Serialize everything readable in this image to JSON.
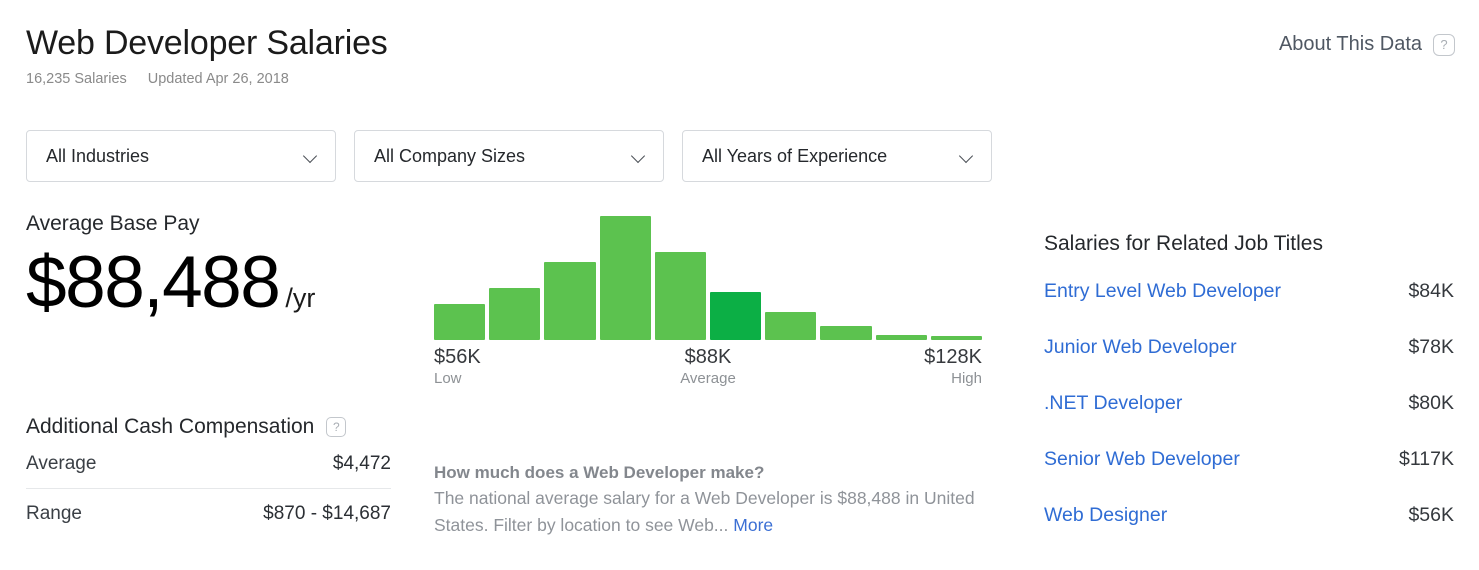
{
  "header": {
    "title": "Web Developer Salaries",
    "salary_count": "16,235 Salaries",
    "updated": "Updated Apr 26, 2018",
    "about_label": "About This Data",
    "help_glyph": "?"
  },
  "filters": [
    {
      "label": "All Industries"
    },
    {
      "label": "All Company Sizes"
    },
    {
      "label": "All Years of Experience"
    }
  ],
  "base_pay": {
    "label": "Average Base Pay",
    "amount": "$88,488",
    "period": "/yr"
  },
  "additional_cash": {
    "label": "Additional Cash Compensation",
    "help_glyph": "?",
    "rows": [
      {
        "label": "Average",
        "value": "$4,472"
      },
      {
        "label": "Range",
        "value": "$870 - $14,687"
      }
    ]
  },
  "description": {
    "question": "How much does a Web Developer make?",
    "body": "The national average salary for a Web Developer is $88,488 in United States. Filter by location to see Web...",
    "more_label": "More"
  },
  "related": {
    "heading": "Salaries for Related Job Titles",
    "items": [
      {
        "title": "Entry Level Web Developer",
        "pay": "$84K"
      },
      {
        "title": "Junior Web Developer",
        "pay": "$78K"
      },
      {
        "title": ".NET Developer",
        "pay": "$80K"
      },
      {
        "title": "Senior Web Developer",
        "pay": "$117K"
      },
      {
        "title": "Web Designer",
        "pay": "$56K"
      }
    ]
  },
  "chart_data": {
    "type": "bar",
    "title": "Base pay salary distribution",
    "xlabel": "",
    "ylabel": "",
    "grid": false,
    "legend": false,
    "categories": [
      "b1",
      "b2",
      "b3",
      "b4",
      "b5",
      "b6",
      "b7",
      "b8",
      "b9",
      "b10"
    ],
    "values": [
      36,
      52,
      78,
      124,
      88,
      48,
      28,
      14,
      5,
      4
    ],
    "ylim": [
      0,
      128
    ],
    "bar_colors": [
      "#5cc24f",
      "#5cc24f",
      "#5cc24f",
      "#5cc24f",
      "#5cc24f",
      "#0caf45",
      "#5cc24f",
      "#5cc24f",
      "#5cc24f",
      "#5cc24f"
    ],
    "highlight_index": 5,
    "colors": {
      "bar": "#5cc24f",
      "highlight": "#0caf45"
    },
    "axis_markers": [
      {
        "value": "$56K",
        "sub": "Low",
        "position": "left"
      },
      {
        "value": "$88K",
        "sub": "Average",
        "position": "center"
      },
      {
        "value": "$128K",
        "sub": "High",
        "position": "right"
      }
    ]
  }
}
